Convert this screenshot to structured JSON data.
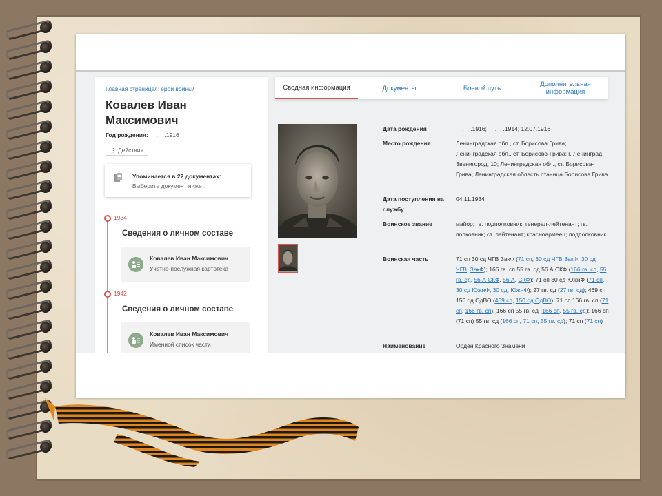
{
  "breadcrumbs": {
    "home": "Главная страница",
    "heroes": "Герои войны",
    "sep": "/"
  },
  "person": {
    "name": "Ковалев Иван Максимович",
    "birth_label": "Год рождения:",
    "birth_value": "__.__.1916"
  },
  "actions_label": "⋮ Действия",
  "mentions": {
    "title": "Упоминается в 22 документах:",
    "subtitle": "Выберите документ ниже ↓"
  },
  "timeline": [
    {
      "year": "1934",
      "heading": "Сведения о личном составе",
      "card_name": "Ковалев Иван Максимович",
      "card_doc": "Учетно-послужная картотека"
    },
    {
      "year": "1942",
      "heading": "Сведения о личном составе",
      "card_name": "Ковалев Иван Максимович",
      "card_doc": "Именной список части"
    }
  ],
  "tabs": [
    {
      "label": "Сводная информация",
      "active": true
    },
    {
      "label": "Документы",
      "active": false
    },
    {
      "label": "Боевой путь",
      "active": false
    },
    {
      "label": "Дополнительная информация",
      "active": false
    }
  ],
  "info": {
    "birth_date": {
      "label": "Дата рождения",
      "value": "__.__.1916; __.__.1914; 12.07.1916"
    },
    "birth_place": {
      "label": "Место рождения",
      "value": "Ленинградская обл., ст. Борисова Грива; Ленинградская обл., ст. Борисово-Грива; г. Ленинград, Звенигород, 10; Ленинградская обл., ст. Борисова-Грива; Ленинградская область станица Борисова Грива"
    },
    "service_date": {
      "label": "Дата поступления на службу",
      "value": "04.11.1934"
    },
    "rank": {
      "label": "Воинское звание",
      "value": "майор; гв. подполковник; генерал-лейтенант; гв. полковник; ст. лейтенант; красноармеец; подполковник"
    },
    "unit": {
      "label": "Воинская часть"
    },
    "award": {
      "label": "Наименование",
      "value": "Орден Красного Знамени"
    }
  },
  "unit_segments": [
    [
      "71 сп 30 сд ЧГВ ЗакФ (",
      false
    ],
    [
      "71 сп",
      true
    ],
    [
      ", ",
      false
    ],
    [
      "30 сд ЧГВ ЗакФ",
      true
    ],
    [
      ", ",
      false
    ],
    [
      "30 сд ЧГВ",
      true
    ],
    [
      ", ",
      false
    ],
    [
      "ЗакФ",
      true
    ],
    [
      "); 166 гв. сп 55 гв. сд 56 А СКФ (",
      false
    ],
    [
      "166 гв. сп",
      true
    ],
    [
      ", ",
      false
    ],
    [
      "55 гв. сд",
      true
    ],
    [
      ", ",
      false
    ],
    [
      "56 А СКФ",
      true
    ],
    [
      ", ",
      false
    ],
    [
      "56 А",
      true
    ],
    [
      ", ",
      false
    ],
    [
      "СКФ",
      true
    ],
    [
      "); 71 сп 30 сд ЮжнФ (",
      false
    ],
    [
      "71 сп",
      true
    ],
    [
      ", ",
      false
    ],
    [
      "30 сд ЮжнФ",
      true
    ],
    [
      ", ",
      false
    ],
    [
      "30 сд",
      true
    ],
    [
      ", ",
      false
    ],
    [
      "ЮжнФ",
      true
    ],
    [
      "); 27 гв. сд (",
      false
    ],
    [
      "27 гв. сд",
      true
    ],
    [
      "); 469 сп 150 сд ОдВО (",
      false
    ],
    [
      "469 сп",
      true
    ],
    [
      ", ",
      false
    ],
    [
      "150 сд ОдВО",
      true
    ],
    [
      "); 71 сп 166 гв. сп (",
      false
    ],
    [
      "71 сп",
      true
    ],
    [
      ", ",
      false
    ],
    [
      "166 гв. сп",
      true
    ],
    [
      "); 166 сп 55 гв. сд (",
      false
    ],
    [
      "166 сп",
      true
    ],
    [
      ", ",
      false
    ],
    [
      "55 гв. сд",
      true
    ],
    [
      "); 166 сп (71 сп) 55 гв. сд (",
      false
    ],
    [
      "166 сп",
      true
    ],
    [
      ", ",
      false
    ],
    [
      "71 сп",
      true
    ],
    [
      ", ",
      false
    ],
    [
      "55 гв. сд",
      true
    ],
    [
      "); 71 сп (",
      false
    ],
    [
      "71 сп",
      true
    ],
    [
      ")",
      false
    ]
  ],
  "colors": {
    "accent": "#d9534f",
    "link": "#2a77b9"
  },
  "icons": {
    "scroll_top": "chevron-up-icon",
    "documents": "documents-icon",
    "person_list": "people-list-icon"
  }
}
